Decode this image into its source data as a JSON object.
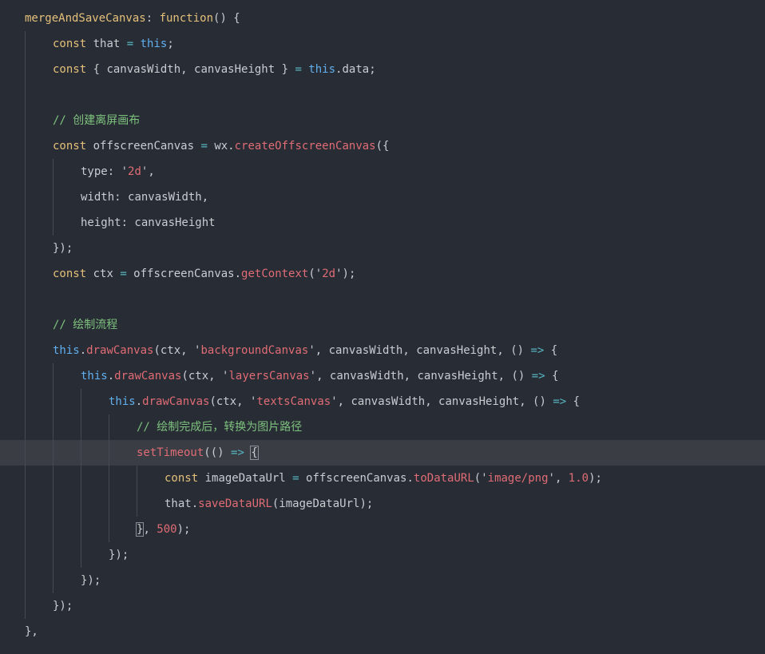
{
  "colors": {
    "background": "#282c34",
    "active_line": "#3a3d43",
    "indent_guide": "#444a53",
    "keyword": "#e5c07b",
    "this_keyword": "#61afef",
    "identifier": "#c9ccd1",
    "operator": "#56b6c2",
    "method_call": "#e06c75",
    "string": "#e06c75",
    "number": "#e06c75",
    "comment": "#7ec27e"
  },
  "editor": {
    "active_line_number": 18,
    "lines": [
      {
        "indent": 0,
        "tokens": [
          {
            "t": "mergeAndSaveCanvas",
            "c": "fn"
          },
          {
            "t": ": ",
            "c": "punc"
          },
          {
            "t": "function",
            "c": "kw"
          },
          {
            "t": "() {",
            "c": "punc"
          }
        ]
      },
      {
        "indent": 1,
        "tokens": [
          {
            "t": "const",
            "c": "kw"
          },
          {
            "t": " that ",
            "c": "var"
          },
          {
            "t": "=",
            "c": "op"
          },
          {
            "t": " ",
            "c": "punc"
          },
          {
            "t": "this",
            "c": "this"
          },
          {
            "t": ";",
            "c": "punc"
          }
        ]
      },
      {
        "indent": 1,
        "tokens": [
          {
            "t": "const",
            "c": "kw"
          },
          {
            "t": " { canvasWidth, canvasHeight } ",
            "c": "var"
          },
          {
            "t": "=",
            "c": "op"
          },
          {
            "t": " ",
            "c": "punc"
          },
          {
            "t": "this",
            "c": "this"
          },
          {
            "t": ".data;",
            "c": "var"
          }
        ]
      },
      {
        "indent": 1,
        "tokens": []
      },
      {
        "indent": 1,
        "tokens": [
          {
            "t": "// 创建离屏画布",
            "c": "cmt"
          }
        ]
      },
      {
        "indent": 1,
        "tokens": [
          {
            "t": "const",
            "c": "kw"
          },
          {
            "t": " offscreenCanvas ",
            "c": "var"
          },
          {
            "t": "=",
            "c": "op"
          },
          {
            "t": " wx.",
            "c": "var"
          },
          {
            "t": "createOffscreenCanvas",
            "c": "call"
          },
          {
            "t": "({",
            "c": "punc"
          }
        ]
      },
      {
        "indent": 2,
        "tokens": [
          {
            "t": "type",
            "c": "prop"
          },
          {
            "t": ": ",
            "c": "punc"
          },
          {
            "t": "'",
            "c": "q"
          },
          {
            "t": "2d",
            "c": "str"
          },
          {
            "t": "'",
            "c": "q"
          },
          {
            "t": ",",
            "c": "punc"
          }
        ]
      },
      {
        "indent": 2,
        "tokens": [
          {
            "t": "width",
            "c": "prop"
          },
          {
            "t": ": canvasWidth,",
            "c": "var"
          }
        ]
      },
      {
        "indent": 2,
        "tokens": [
          {
            "t": "height",
            "c": "prop"
          },
          {
            "t": ": canvasHeight",
            "c": "var"
          }
        ]
      },
      {
        "indent": 1,
        "tokens": [
          {
            "t": "});",
            "c": "punc"
          }
        ]
      },
      {
        "indent": 1,
        "tokens": [
          {
            "t": "const",
            "c": "kw"
          },
          {
            "t": " ctx ",
            "c": "var"
          },
          {
            "t": "=",
            "c": "op"
          },
          {
            "t": " offscreenCanvas.",
            "c": "var"
          },
          {
            "t": "getContext",
            "c": "call"
          },
          {
            "t": "(",
            "c": "punc"
          },
          {
            "t": "'",
            "c": "q"
          },
          {
            "t": "2d",
            "c": "str"
          },
          {
            "t": "'",
            "c": "q"
          },
          {
            "t": ");",
            "c": "punc"
          }
        ]
      },
      {
        "indent": 1,
        "tokens": []
      },
      {
        "indent": 1,
        "tokens": [
          {
            "t": "// 绘制流程",
            "c": "cmt"
          }
        ]
      },
      {
        "indent": 1,
        "tokens": [
          {
            "t": "this",
            "c": "this"
          },
          {
            "t": ".",
            "c": "punc"
          },
          {
            "t": "drawCanvas",
            "c": "call"
          },
          {
            "t": "(ctx, ",
            "c": "var"
          },
          {
            "t": "'",
            "c": "q"
          },
          {
            "t": "backgroundCanvas",
            "c": "str"
          },
          {
            "t": "'",
            "c": "q"
          },
          {
            "t": ", canvasWidth, canvasHeight, () ",
            "c": "var"
          },
          {
            "t": "=>",
            "c": "op"
          },
          {
            "t": " {",
            "c": "punc"
          }
        ]
      },
      {
        "indent": 2,
        "tokens": [
          {
            "t": "this",
            "c": "this"
          },
          {
            "t": ".",
            "c": "punc"
          },
          {
            "t": "drawCanvas",
            "c": "call"
          },
          {
            "t": "(ctx, ",
            "c": "var"
          },
          {
            "t": "'",
            "c": "q"
          },
          {
            "t": "layersCanvas",
            "c": "str"
          },
          {
            "t": "'",
            "c": "q"
          },
          {
            "t": ", canvasWidth, canvasHeight, () ",
            "c": "var"
          },
          {
            "t": "=>",
            "c": "op"
          },
          {
            "t": " {",
            "c": "punc"
          }
        ]
      },
      {
        "indent": 3,
        "tokens": [
          {
            "t": "this",
            "c": "this"
          },
          {
            "t": ".",
            "c": "punc"
          },
          {
            "t": "drawCanvas",
            "c": "call"
          },
          {
            "t": "(ctx, ",
            "c": "var"
          },
          {
            "t": "'",
            "c": "q"
          },
          {
            "t": "textsCanvas",
            "c": "str"
          },
          {
            "t": "'",
            "c": "q"
          },
          {
            "t": ", canvasWidth, canvasHeight, () ",
            "c": "var"
          },
          {
            "t": "=>",
            "c": "op"
          },
          {
            "t": " {",
            "c": "punc"
          }
        ]
      },
      {
        "indent": 4,
        "tokens": [
          {
            "t": "// 绘制完成后，转换为图片路径",
            "c": "cmt"
          }
        ]
      },
      {
        "indent": 4,
        "tokens": [
          {
            "t": "setTimeout",
            "c": "call"
          },
          {
            "t": "(() ",
            "c": "punc"
          },
          {
            "t": "=>",
            "c": "op"
          },
          {
            "t": " ",
            "c": "punc"
          },
          {
            "t": "{",
            "c": "punc",
            "box": true
          }
        ]
      },
      {
        "indent": 5,
        "tokens": [
          {
            "t": "const",
            "c": "kw"
          },
          {
            "t": " imageDataUrl ",
            "c": "var"
          },
          {
            "t": "=",
            "c": "op"
          },
          {
            "t": " offscreenCanvas.",
            "c": "var"
          },
          {
            "t": "toDataURL",
            "c": "call"
          },
          {
            "t": "(",
            "c": "punc"
          },
          {
            "t": "'",
            "c": "q"
          },
          {
            "t": "image/png",
            "c": "str"
          },
          {
            "t": "'",
            "c": "q"
          },
          {
            "t": ", ",
            "c": "punc"
          },
          {
            "t": "1.0",
            "c": "num"
          },
          {
            "t": ");",
            "c": "punc"
          }
        ]
      },
      {
        "indent": 5,
        "tokens": [
          {
            "t": "that.",
            "c": "var"
          },
          {
            "t": "saveDataURL",
            "c": "call"
          },
          {
            "t": "(imageDataUrl);",
            "c": "var"
          }
        ]
      },
      {
        "indent": 4,
        "tokens": [
          {
            "t": "}",
            "c": "punc",
            "box": true
          },
          {
            "t": ", ",
            "c": "punc"
          },
          {
            "t": "500",
            "c": "num"
          },
          {
            "t": ");",
            "c": "punc"
          }
        ]
      },
      {
        "indent": 3,
        "tokens": [
          {
            "t": "});",
            "c": "punc"
          }
        ]
      },
      {
        "indent": 2,
        "tokens": [
          {
            "t": "});",
            "c": "punc"
          }
        ]
      },
      {
        "indent": 1,
        "tokens": [
          {
            "t": "});",
            "c": "punc"
          }
        ]
      },
      {
        "indent": 0,
        "tokens": [
          {
            "t": "},",
            "c": "punc"
          }
        ]
      }
    ]
  }
}
